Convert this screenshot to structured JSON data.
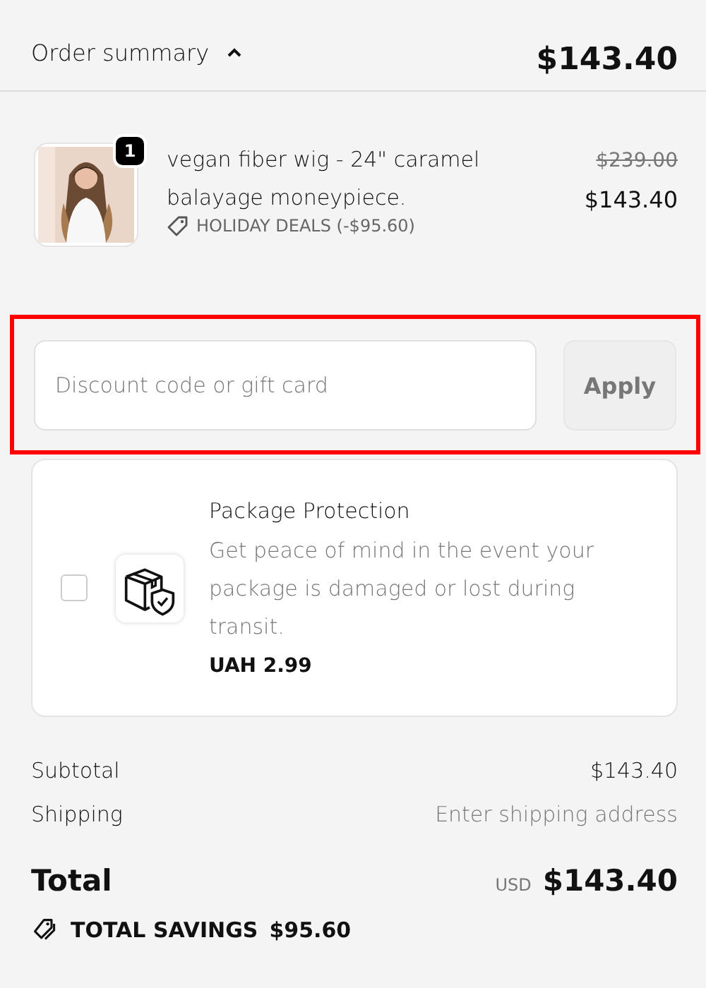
{
  "header": {
    "title": "Order summary",
    "expanded": true,
    "total": "$143.40"
  },
  "items": [
    {
      "quantity": "1",
      "name": "vegan fiber wig - 24\" caramel balayage moneypiece.",
      "discount": "HOLIDAY DEALS (-$95.60)",
      "original_price": "$239.00",
      "price": "$143.40"
    }
  ],
  "discount": {
    "placeholder": "Discount code or gift card",
    "button": "Apply",
    "highlighted": true
  },
  "protection": {
    "checked": false,
    "title": "Package Protection",
    "description": "Get peace of mind in the event your package is damaged or lost during transit.",
    "price": "UAH 2.99"
  },
  "summary": [
    {
      "label": "Subtotal",
      "value": "$143.40",
      "kind": "amount"
    },
    {
      "label": "Shipping",
      "value": "Enter shipping address",
      "kind": "hint"
    }
  ],
  "total": {
    "label": "Total",
    "currency": "USD",
    "value": "$143.40"
  },
  "savings": {
    "label": "TOTAL SAVINGS",
    "value": "$95.60"
  }
}
